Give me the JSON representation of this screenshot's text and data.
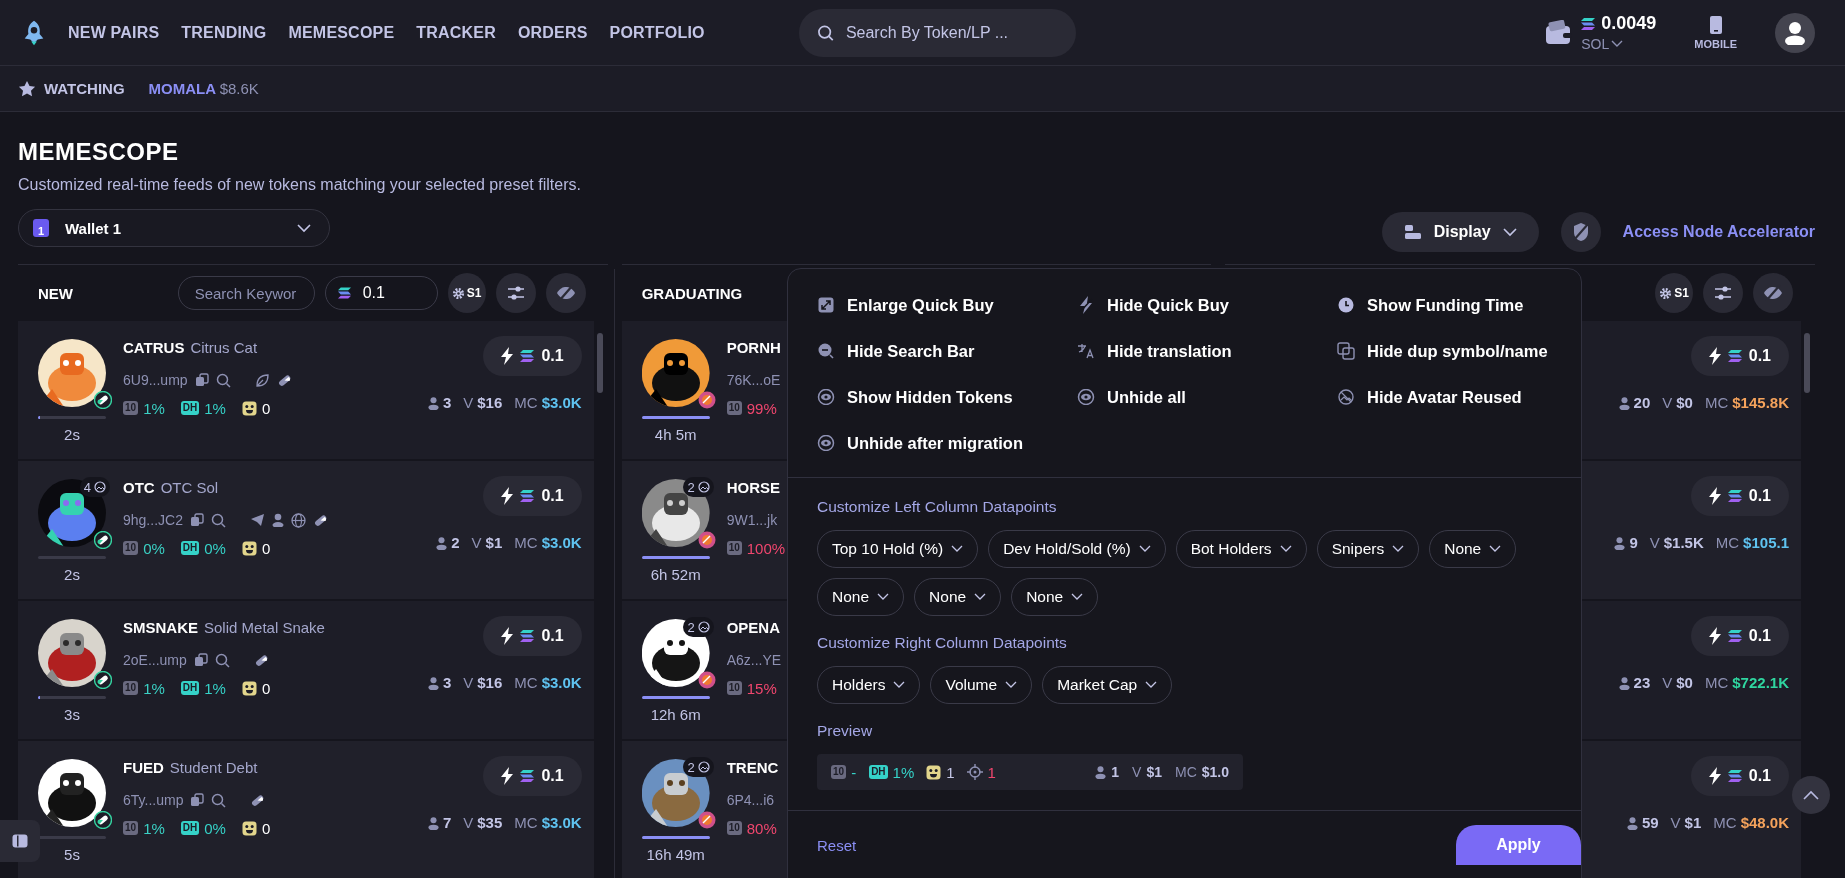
{
  "nav": [
    "NEW PAIRS",
    "TRENDING",
    "MEMESCOPE",
    "TRACKER",
    "ORDERS",
    "PORTFOLIO"
  ],
  "search": {
    "placeholder": "Search By Token/LP ..."
  },
  "balance": {
    "amount": "0.0049",
    "currency": "SOL"
  },
  "mobile": {
    "label": "MOBILE"
  },
  "watchlist": {
    "label": "WATCHING",
    "items": [
      {
        "symbol": "MOMALA",
        "value": "$8.6K"
      }
    ]
  },
  "page": {
    "title": "MEMESCOPE",
    "subtitle": "Customized real-time feeds of new tokens matching your selected preset filters."
  },
  "wallet": {
    "badge": "1",
    "label": "Wallet 1"
  },
  "display": {
    "label": "Display"
  },
  "accelerator": {
    "label": "Access Node Accelerator"
  },
  "columns": [
    {
      "title": "NEW",
      "search_placeholder": "Search Keywor",
      "amount": "0.1",
      "preset": "S1",
      "cards": [
        {
          "symbol": "CATRUS",
          "name": "Citrus Cat",
          "address": "6U9...ump",
          "links": [
            {
              "kind": "leaf"
            },
            {
              "kind": "pill"
            }
          ],
          "top10": {
            "tag": "10",
            "value": "1%",
            "color": "#3ad0c4"
          },
          "dev": {
            "tag": "DH",
            "value": "1%"
          },
          "bots": "0",
          "holders": "3",
          "volume": {
            "label": "V",
            "value": "$16"
          },
          "mcap": {
            "label": "MC",
            "value": "$3.0K",
            "color": "#5fc3f0"
          },
          "buy": "0.1",
          "age": "2s",
          "level": 0.03,
          "kind": "pump"
        },
        {
          "symbol": "OTC",
          "name": "OTC Sol",
          "address": "9hg...JC2",
          "image_count": "4",
          "links": [
            {
              "kind": "telegram"
            },
            {
              "kind": "person"
            },
            {
              "kind": "globe"
            },
            {
              "kind": "pill"
            }
          ],
          "top10": {
            "tag": "10",
            "value": "0%",
            "color": "#3ad0c4"
          },
          "dev": {
            "tag": "DH",
            "value": "0%"
          },
          "bots": "0",
          "holders": "2",
          "volume": {
            "label": "V",
            "value": "$1"
          },
          "mcap": {
            "label": "MC",
            "value": "$3.0K",
            "color": "#5fc3f0"
          },
          "buy": "0.1",
          "age": "2s",
          "level": 0,
          "kind": "pump"
        },
        {
          "symbol": "SMSNAKE",
          "name": "Solid Metal Snake",
          "address": "2oE...ump",
          "links": [
            {
              "kind": "pill"
            }
          ],
          "top10": {
            "tag": "10",
            "value": "1%",
            "color": "#3ad0c4"
          },
          "dev": {
            "tag": "DH",
            "value": "1%"
          },
          "bots": "0",
          "holders": "3",
          "volume": {
            "label": "V",
            "value": "$16"
          },
          "mcap": {
            "label": "MC",
            "value": "$3.0K",
            "color": "#5fc3f0"
          },
          "buy": "0.1",
          "age": "3s",
          "level": 0.03,
          "kind": "pump"
        },
        {
          "symbol": "FUED",
          "name": "Student Debt",
          "address": "6Ty...ump",
          "links": [
            {
              "kind": "pill"
            }
          ],
          "top10": {
            "tag": "10",
            "value": "1%",
            "color": "#3ad0c4"
          },
          "dev": {
            "tag": "DH",
            "value": "0%"
          },
          "bots": "0",
          "holders": "7",
          "volume": {
            "label": "V",
            "value": "$35"
          },
          "mcap": {
            "label": "MC",
            "value": "$3.0K",
            "color": "#5fc3f0"
          },
          "buy": "0.1",
          "age": "5s",
          "level": 0.02,
          "kind": "pump"
        }
      ]
    },
    {
      "title": "GRADUATING",
      "cards": [
        {
          "symbol": "PORNH",
          "address": "76K...oE",
          "top10": {
            "tag": "10",
            "value": "99%",
            "color": "#f0466e"
          },
          "age": "4h 5m",
          "level": 1,
          "kind": "launch"
        },
        {
          "symbol": "HORSE",
          "address": "9W1...jk",
          "image_count": "2",
          "top10": {
            "tag": "10",
            "value": "100%",
            "color": "#f0466e"
          },
          "age": "6h 52m",
          "level": 1,
          "kind": "launch"
        },
        {
          "symbol": "OPENA",
          "address": "A6z...YE",
          "image_count": "2",
          "top10": {
            "tag": "10",
            "value": "15%",
            "color": "#f0466e"
          },
          "age": "12h 6m",
          "level": 1,
          "kind": "launch"
        },
        {
          "symbol": "TRENC",
          "address": "6P4...i6",
          "image_count": "2",
          "top10": {
            "tag": "10",
            "value": "80%",
            "color": "#f0466e"
          },
          "age": "16h 49m",
          "level": 1,
          "kind": "launch"
        }
      ]
    },
    {
      "preset": "S1",
      "cards": [
        {
          "holders": "20",
          "volume": {
            "label": "V",
            "value": "$0"
          },
          "mcap": {
            "label": "MC",
            "value": "$145.8K",
            "color": "#f5a35c"
          },
          "buy": "0.1"
        },
        {
          "holders": "9",
          "volume": {
            "label": "V",
            "value": "$1.5K"
          },
          "mcap": {
            "label": "MC",
            "value": "$105.1",
            "color": "#5fc3f0"
          },
          "buy": "0.1"
        },
        {
          "holders": "23",
          "volume": {
            "label": "V",
            "value": "$0"
          },
          "mcap": {
            "label": "MC",
            "value": "$722.1K",
            "color": "#2fd6a0"
          },
          "buy": "0.1"
        },
        {
          "holders": "59",
          "volume": {
            "label": "V",
            "value": "$1"
          },
          "mcap": {
            "label": "MC",
            "value": "$48.0K",
            "color": "#f5a35c"
          },
          "buy": "0.1"
        }
      ]
    }
  ],
  "display_menu": {
    "options": [
      {
        "label": "Enlarge Quick Buy",
        "kind": "enlarge"
      },
      {
        "label": "Hide Quick Buy",
        "kind": "bolt"
      },
      {
        "label": "Show Funding Time",
        "kind": "clock"
      },
      {
        "label": "Hide Search Bar",
        "kind": "search"
      },
      {
        "label": "Hide translation",
        "kind": "translate"
      },
      {
        "label": "Hide dup symbol/name",
        "kind": "duplicate"
      },
      {
        "label": "Show Hidden Tokens",
        "kind": "eye"
      },
      {
        "label": "Unhide all",
        "kind": "eye"
      },
      {
        "label": "Hide Avatar Reused",
        "kind": "avatar"
      },
      {
        "label": "Unhide after migration",
        "kind": "eye"
      }
    ],
    "left_title": "Customize Left Column Datapoints",
    "left": [
      "Top 10 Hold (%)",
      "Dev Hold/Sold (%)",
      "Bot Holders",
      "Snipers",
      "None",
      "None",
      "None",
      "None"
    ],
    "right_title": "Customize Right Column Datapoints",
    "right": [
      "Holders",
      "Volume",
      "Market Cap"
    ],
    "preview_title": "Preview",
    "preview": {
      "top10": {
        "tag": "10",
        "value": "-"
      },
      "dev": {
        "tag": "DH",
        "value": "1%"
      },
      "bots": "1",
      "snipers": "1",
      "holders": "1",
      "volume": {
        "label": "V",
        "value": "$1"
      },
      "mcap": {
        "label": "MC",
        "value": "$1.0"
      }
    },
    "reset": "Reset",
    "apply": "Apply"
  }
}
